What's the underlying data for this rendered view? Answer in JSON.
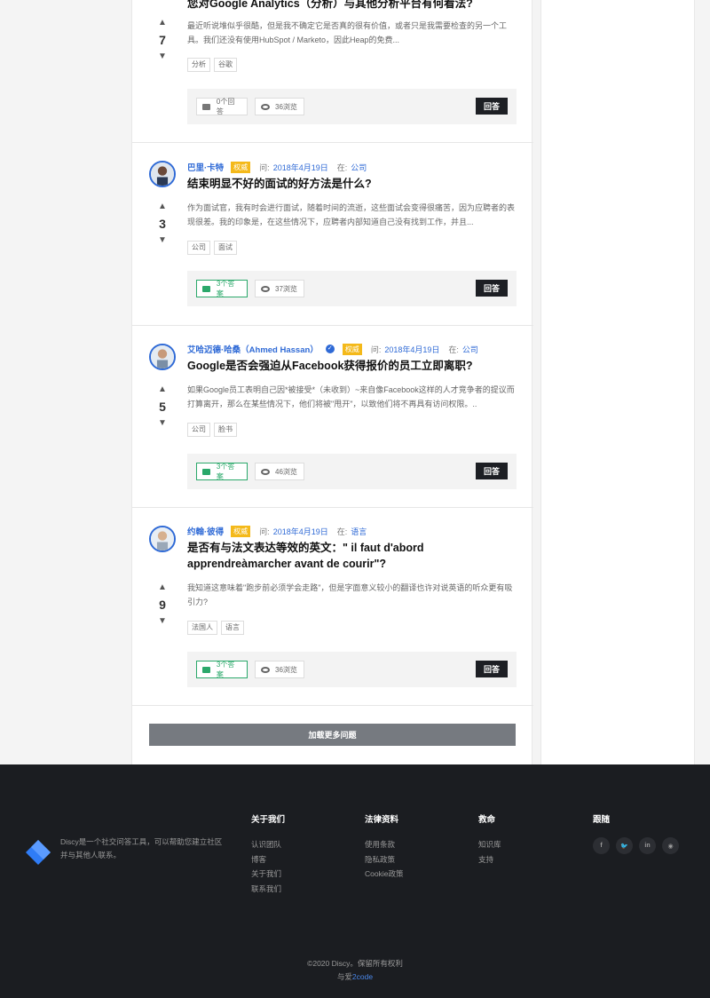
{
  "top_question": {
    "title": "您对Google Analytics（分析）与其他分析平台有何看法?",
    "votes": "7",
    "excerpt": "最近听说堆似乎很酷，但是我不确定它是否真的很有价值，或者只是我需要检查的另一个工具。我们还没有使用HubSpot / Marketo，因此Heap的免费...",
    "tags": [
      "分析",
      "谷歌"
    ],
    "answers": "0个回答",
    "views": "36浏览",
    "answer_btn": "回答"
  },
  "questions": [
    {
      "author": "巴里·卡特",
      "badge": "权威",
      "asked": "问:",
      "date": "2018年4月19日",
      "in": "在:",
      "category": "公司",
      "title": "结束明显不好的面试的好方法是什么?",
      "votes": "3",
      "excerpt": "作为面试官，我有时会进行面试，随着时间的流逝，这些面试会变得很痛苦，因为应聘者的表现很差。我的印象是，在这些情况下，应聘者内部知道自己没有找到工作，并且...",
      "tags": [
        "公司",
        "面试"
      ],
      "answers": "3个答案",
      "views": "37浏览",
      "answer_btn": "回答"
    },
    {
      "author": "艾哈迈德·哈桑（Ahmed Hassan）",
      "badge": "权威",
      "asked": "问:",
      "date": "2018年4月19日",
      "in": "在:",
      "category": "公司",
      "title": "Google是否会强迫从Facebook获得报价的员工立即离职?",
      "votes": "5",
      "excerpt": "如果Google员工表明自己因*被接受*（未收到）~来自像Facebook这样的人才竞争者的提议而打算离开，那么在某些情况下，他们将被\"甩开\"，以致他们将不再具有访问权限。..",
      "tags": [
        "公司",
        "脸书"
      ],
      "answers": "3个答案",
      "views": "46浏览",
      "answer_btn": "回答"
    },
    {
      "author": "约翰·彼得",
      "badge": "权威",
      "asked": "问:",
      "date": "2018年4月19日",
      "in": "在:",
      "category": "语言",
      "title": "是否有与法文表达等效的英文：\" il faut d'abord apprendreàmarcher avant de courir\"?",
      "votes": "9",
      "excerpt": "我知道这意味着\"跑步前必须学会走路\"，但是字面意义较小的翻译也许对说英语的听众更有吸引力?",
      "tags": [
        "法国人",
        "语言"
      ],
      "answers": "3个答案",
      "views": "36浏览",
      "answer_btn": "回答"
    }
  ],
  "load_more": "加载更多问题",
  "footer": {
    "description": "Discy是一个社交问答工具，可以帮助您建立社区并与其他人联系。",
    "columns": [
      {
        "heading": "关于我们",
        "links": [
          "认识团队",
          "博客",
          "关于我们",
          "联系我们"
        ]
      },
      {
        "heading": "法律资料",
        "links": [
          "使用条款",
          "隐私政策",
          "Cookie政策"
        ]
      },
      {
        "heading": "救命",
        "links": [
          "知识库",
          "支持"
        ]
      }
    ],
    "follow_heading": "跟随",
    "social": [
      "f",
      "t",
      "in",
      "rss"
    ],
    "copyright": "©2020 Discy。保留所有权利",
    "made_prefix": "与爱",
    "made_brand": "2code"
  },
  "colors": {
    "accent": "#2f6ad6",
    "badge": "#f4b91a",
    "green": "#2aa86a",
    "footer_bg": "#1b1d21"
  }
}
